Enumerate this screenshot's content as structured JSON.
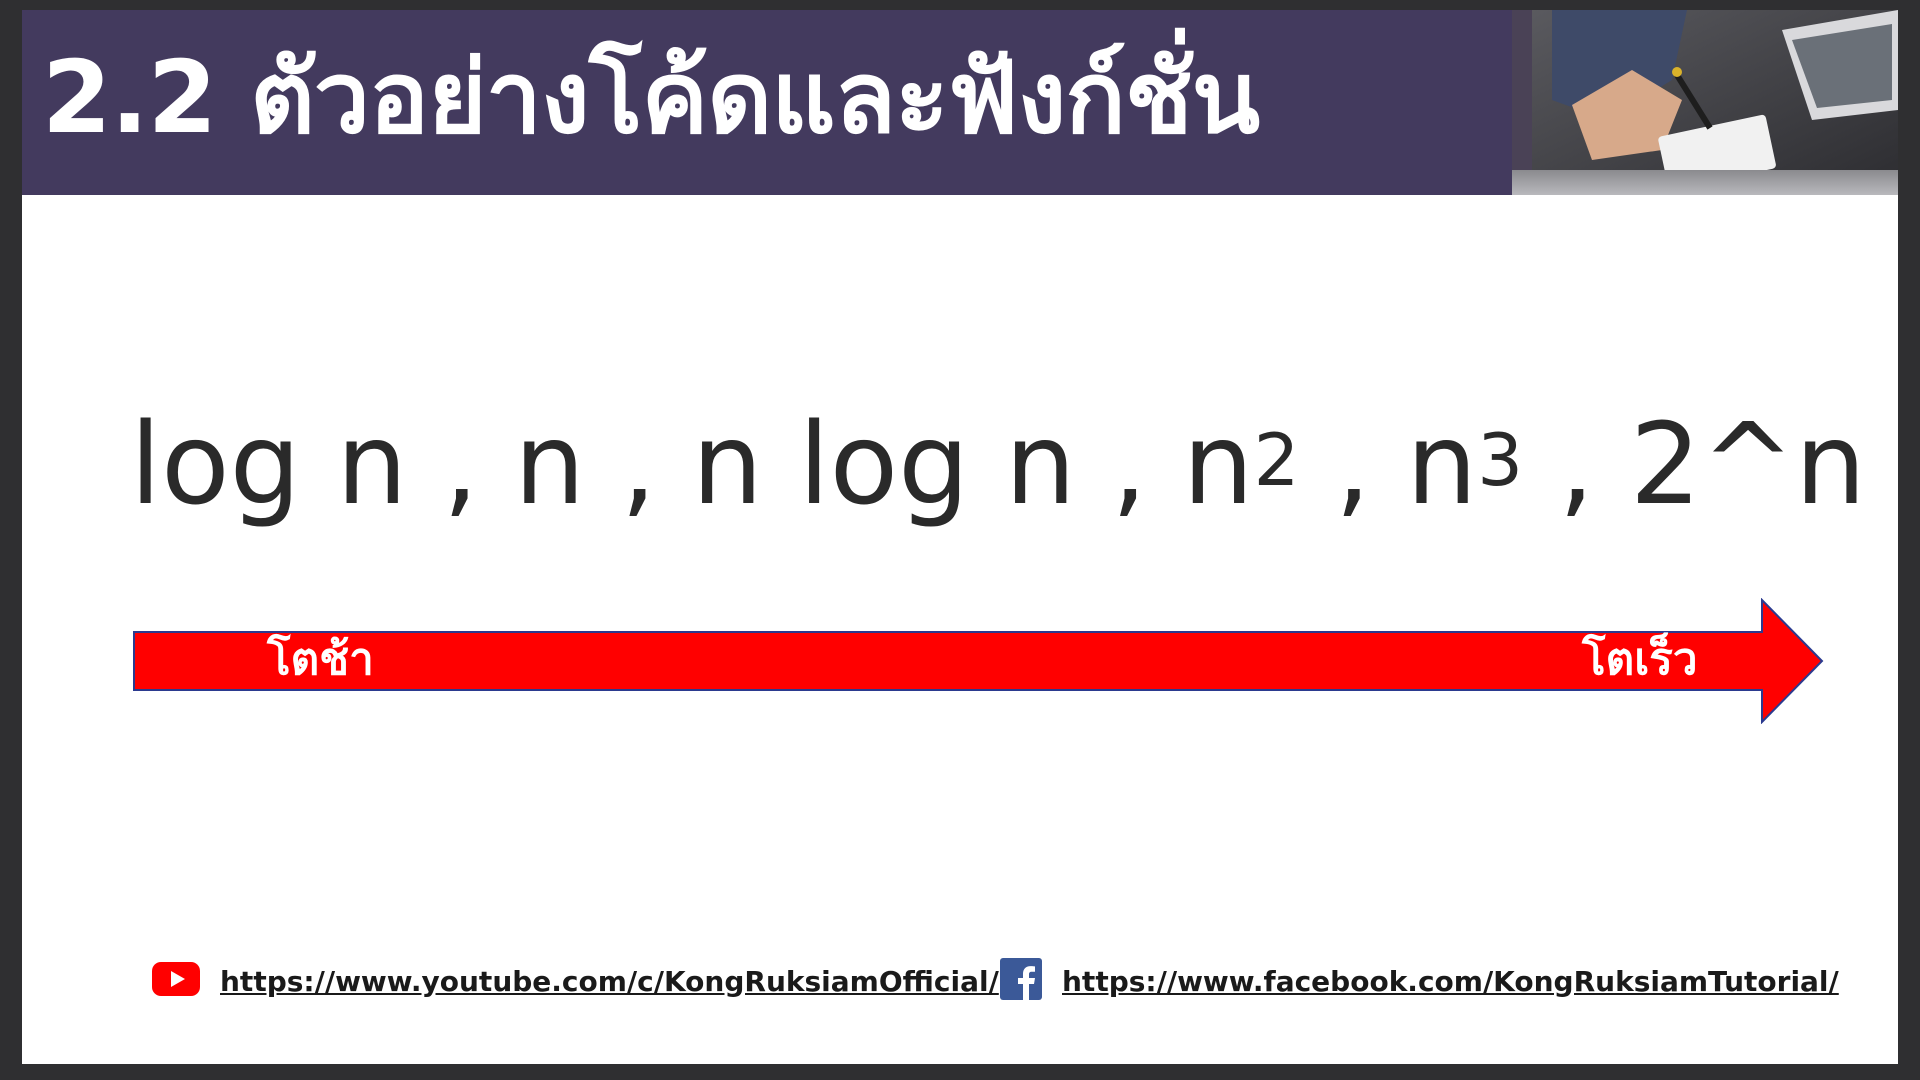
{
  "slide": {
    "title": "2.2 ตัวอย่างโค้ดและฟังก์ชั่น",
    "formula": {
      "parts": [
        "log n , n , n log n , n",
        "2",
        " , n",
        "3",
        " , 2^n"
      ]
    },
    "arrow": {
      "left_label": "โตช้า",
      "right_label": "โตเร็ว",
      "color": "#ff0000",
      "border_color": "#2b3a8f"
    },
    "photo": {
      "icon": "office-photo-icon"
    }
  },
  "links": {
    "youtube": {
      "icon": "youtube-icon",
      "text": "https://www.youtube.com/c/KongRuksiamOfficial/"
    },
    "facebook": {
      "icon": "facebook-icon",
      "text": "https://www.facebook.com/KongRuksiamTutorial/"
    }
  },
  "colors": {
    "title_bar": "#433a5e",
    "frame": "#2f2f31",
    "youtube_red": "#ff0000",
    "facebook_blue": "#3b5998"
  }
}
